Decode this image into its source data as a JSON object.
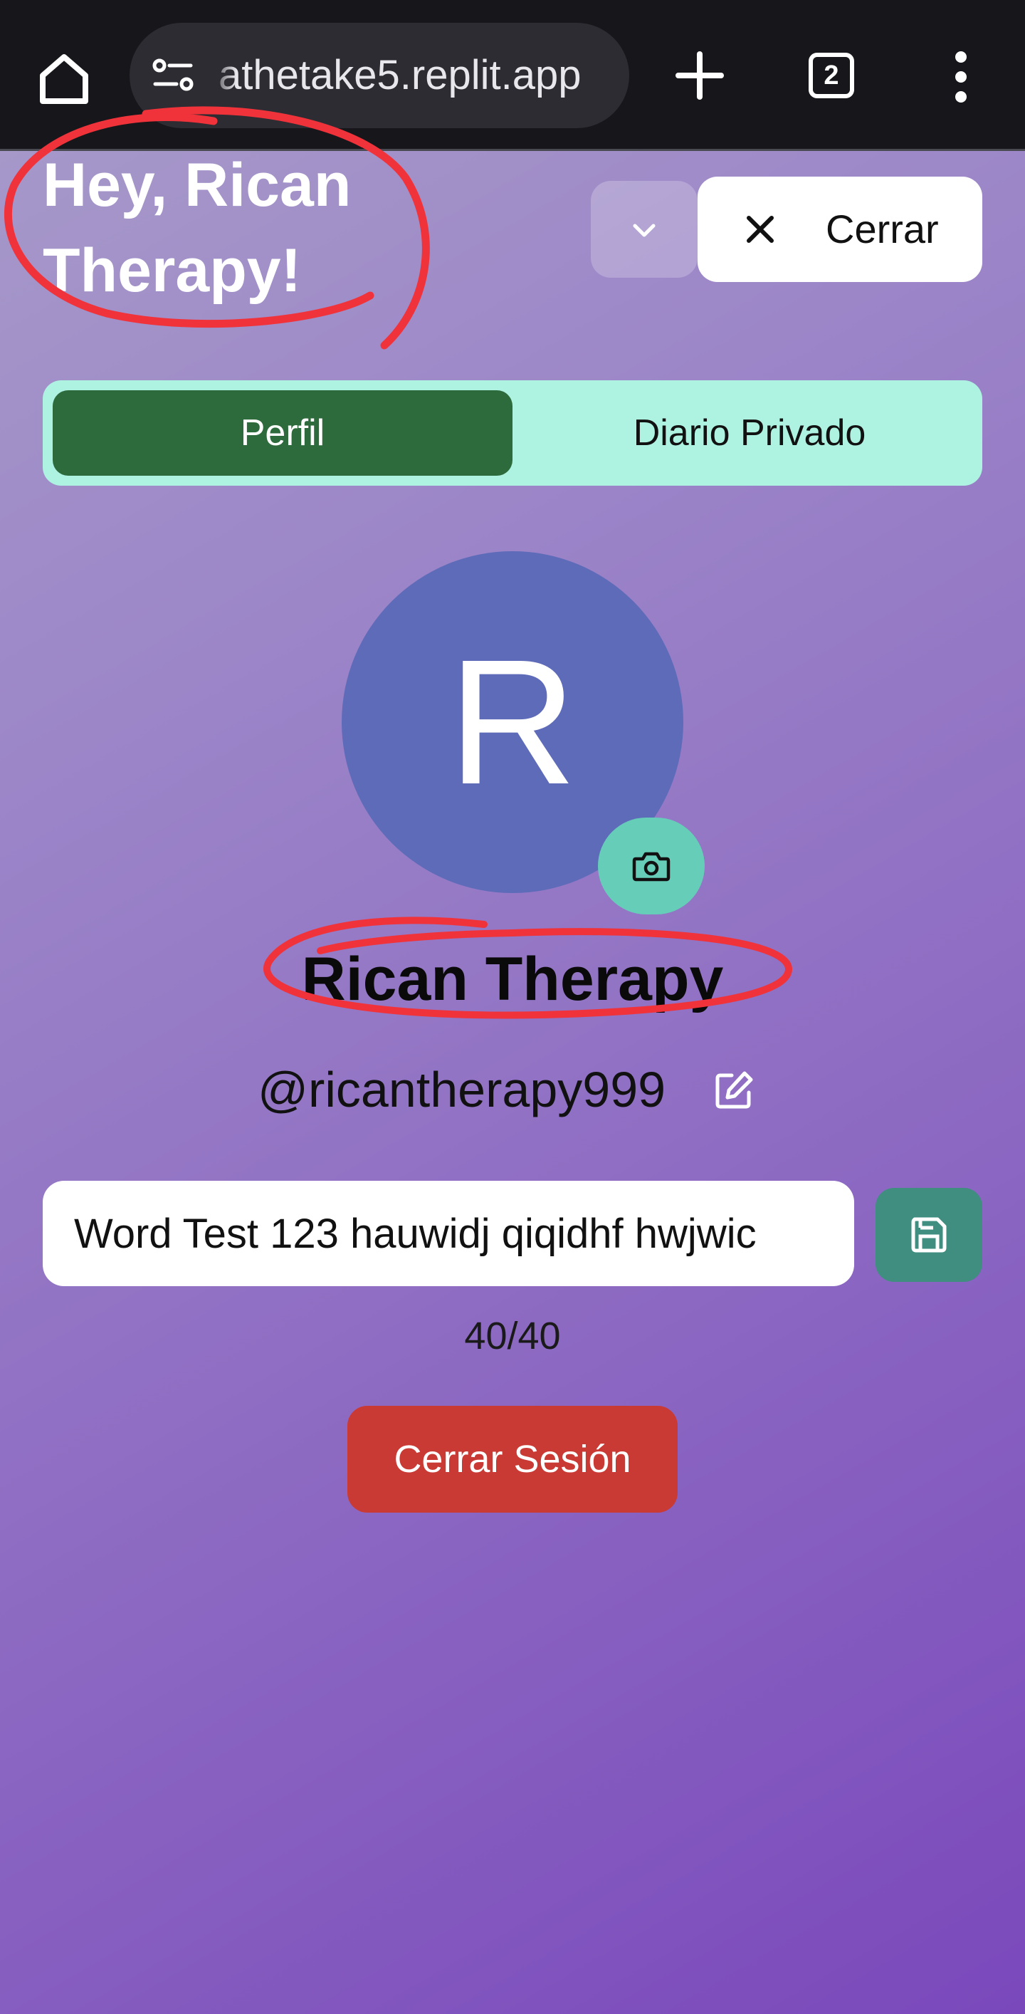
{
  "browser": {
    "url": "athetake5.replit.app",
    "tab_count": "2"
  },
  "header": {
    "greeting": "Hey, Rican Therapy!",
    "close_label": "Cerrar"
  },
  "tabs": [
    {
      "label": "Perfil",
      "active": true
    },
    {
      "label": "Diario Privado",
      "active": false
    }
  ],
  "profile": {
    "avatar_initial": "R",
    "avatar_color": "#5e6bb9",
    "display_name": "Rican Therapy",
    "username": "@ricantherapy999",
    "bio_value": "Word Test 123 hauwidj qiqidhf hwjwic",
    "char_count": "40/40"
  },
  "actions": {
    "logout_label": "Cerrar Sesión"
  },
  "colors": {
    "tab_bar": "#aef2e2",
    "active_tab": "#2e6b3c",
    "camera_button": "#66cdb9",
    "save_button": "#3f8e80",
    "logout_button": "#c93a35",
    "annotation": "#f0333a"
  },
  "icons": {
    "home": "home-icon",
    "site_settings": "site-settings-icon",
    "new_tab": "plus-icon",
    "more": "more-vertical-icon",
    "collapse": "chevron-down-icon",
    "close": "close-icon",
    "camera": "camera-icon",
    "edit": "edit-icon",
    "save": "save-icon"
  }
}
